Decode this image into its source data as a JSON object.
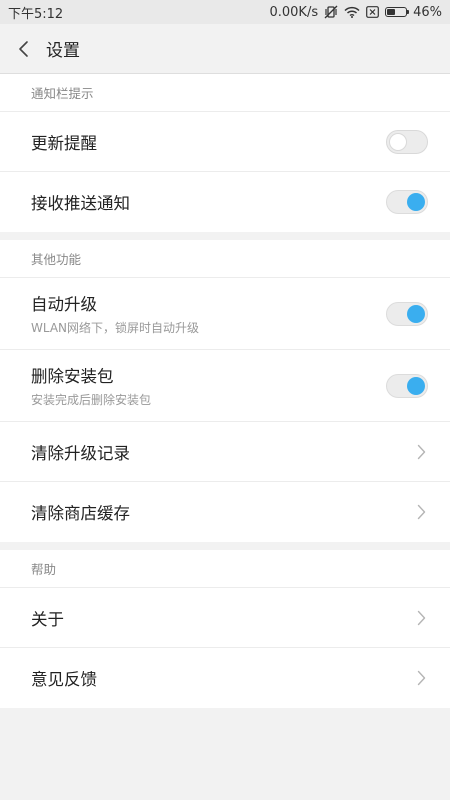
{
  "status_bar": {
    "time": "下午5:12",
    "network_speed": "0.00K/s",
    "battery_percent": "46%",
    "battery_level": 0.46,
    "icons": [
      "vibrate-off-icon",
      "wifi-icon",
      "sim-off-icon",
      "battery-icon"
    ]
  },
  "header": {
    "title": "设置",
    "back_icon": "chevron-left-icon"
  },
  "sections": [
    {
      "header": "通知栏提示",
      "items": [
        {
          "label": "更新提醒",
          "control": "toggle",
          "state": "off"
        },
        {
          "label": "接收推送通知",
          "control": "toggle",
          "state": "on"
        }
      ]
    },
    {
      "header": "其他功能",
      "items": [
        {
          "label": "自动升级",
          "sub": "WLAN网络下，锁屏时自动升级",
          "control": "toggle",
          "state": "on"
        },
        {
          "label": "删除安装包",
          "sub": "安装完成后删除安装包",
          "control": "toggle",
          "state": "on"
        },
        {
          "label": "清除升级记录",
          "control": "chevron"
        },
        {
          "label": "清除商店缓存",
          "control": "chevron"
        }
      ]
    },
    {
      "header": "帮助",
      "items": [
        {
          "label": "关于",
          "control": "chevron"
        },
        {
          "label": "意见反馈",
          "control": "chevron"
        }
      ]
    }
  ],
  "colors": {
    "accent": "#3aaeef",
    "background": "#f2f2f2",
    "card": "#ffffff",
    "section_header_text": "#888888"
  }
}
